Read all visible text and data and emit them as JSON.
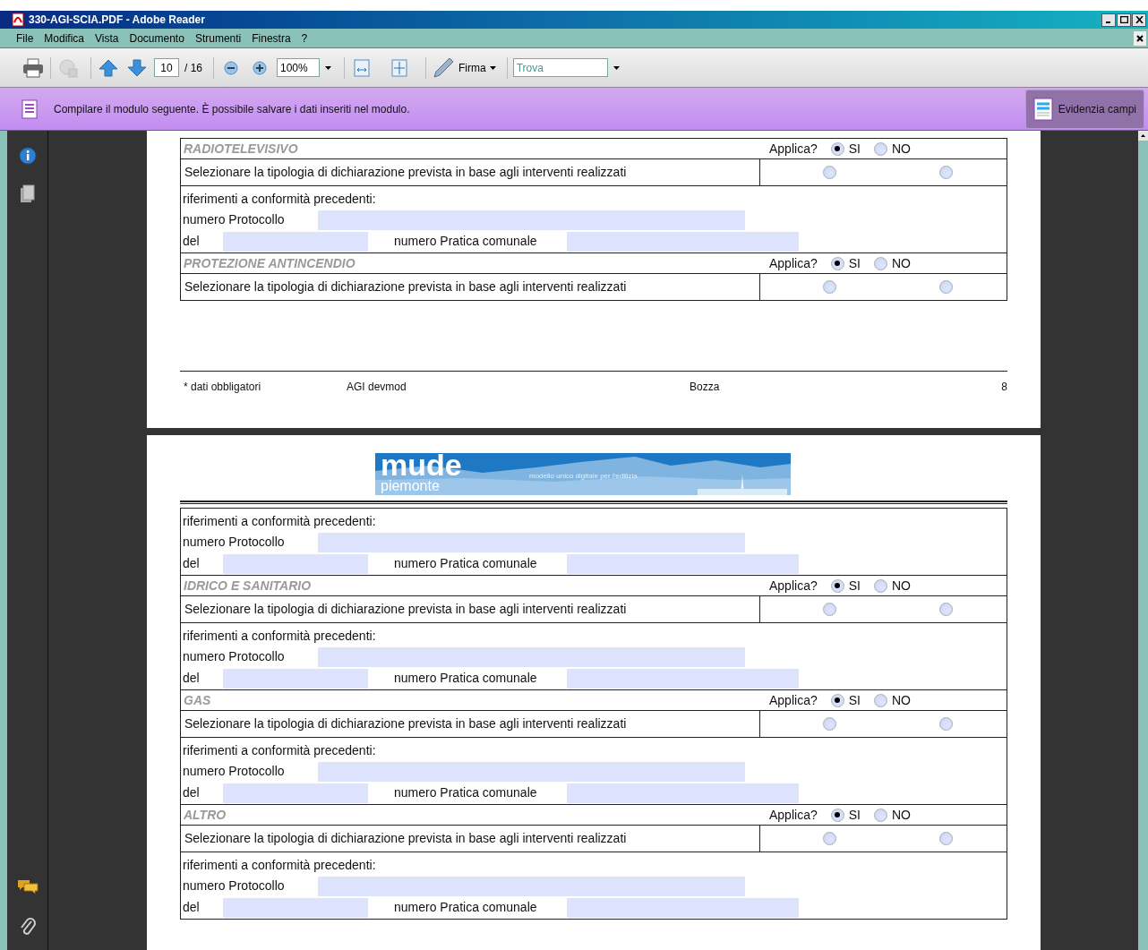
{
  "window": {
    "title": "330-AGI-SCIA.PDF - Adobe Reader"
  },
  "menu": [
    "File",
    "Modifica",
    "Vista",
    "Documento",
    "Strumenti",
    "Finestra",
    "?"
  ],
  "toolbar": {
    "page_number": "10",
    "page_total": "/ 16",
    "zoom": "100%",
    "sign_label": "Firma",
    "search_placeholder": "Trova"
  },
  "notice": {
    "text": "Compilare il modulo seguente. È possibile salvare i dati inseriti nel modulo.",
    "button": "Evidenzia campi"
  },
  "page_1": {
    "rows": [
      {
        "kind": "header",
        "title": "RADIOTELEVISIVO",
        "question": "Applica?",
        "options": [
          {
            "label": "SI",
            "selected": true
          },
          {
            "label": "NO",
            "selected": false
          }
        ]
      },
      {
        "kind": "select",
        "label": "Selezionare la tipologia di dichiarazione prevista in base agli interventi realizzati",
        "options": [
          {
            "selected": false
          },
          {
            "selected": false
          }
        ]
      },
      {
        "kind": "refs",
        "heading": "riferimenti a conformità precedenti:",
        "protocol_label": "numero Protocollo",
        "date_label": "del",
        "pratica_label": "numero Pratica comunale"
      },
      {
        "kind": "header",
        "title": "PROTEZIONE ANTINCENDIO",
        "question": "Applica?",
        "options": [
          {
            "label": "SI",
            "selected": true
          },
          {
            "label": "NO",
            "selected": false
          }
        ]
      },
      {
        "kind": "select",
        "label": "Selezionare la tipologia di dichiarazione prevista in base agli interventi realizzati",
        "options": [
          {
            "selected": false
          },
          {
            "selected": false
          }
        ]
      }
    ],
    "footer": {
      "note": "* dati obbligatori",
      "code": "AGI devmod",
      "status": "Bozza",
      "page": "8"
    }
  },
  "page_2": {
    "logo": {
      "wordmark": "mude",
      "region": "piemonte",
      "tagline": "modello unico digitale per l'edilizia"
    },
    "rows": [
      {
        "kind": "refs",
        "heading": "riferimenti a conformità precedenti:",
        "protocol_label": "numero Protocollo",
        "date_label": "del",
        "pratica_label": "numero Pratica comunale"
      },
      {
        "kind": "header",
        "title": "IDRICO E SANITARIO",
        "question": "Applica?",
        "options": [
          {
            "label": "SI",
            "selected": true
          },
          {
            "label": "NO",
            "selected": false
          }
        ]
      },
      {
        "kind": "select",
        "label": "Selezionare la tipologia di dichiarazione prevista in base agli interventi realizzati",
        "options": [
          {
            "selected": false
          },
          {
            "selected": false
          }
        ]
      },
      {
        "kind": "refs",
        "heading": "riferimenti a conformità precedenti:",
        "protocol_label": "numero Protocollo",
        "date_label": "del",
        "pratica_label": "numero Pratica comunale"
      },
      {
        "kind": "header",
        "title": "GAS",
        "question": "Applica?",
        "options": [
          {
            "label": "SI",
            "selected": true
          },
          {
            "label": "NO",
            "selected": false
          }
        ]
      },
      {
        "kind": "select",
        "label": "Selezionare la tipologia di dichiarazione prevista in base agli interventi realizzati",
        "options": [
          {
            "selected": false
          },
          {
            "selected": false
          }
        ]
      },
      {
        "kind": "refs",
        "heading": "riferimenti a conformità precedenti:",
        "protocol_label": "numero Protocollo",
        "date_label": "del",
        "pratica_label": "numero Pratica comunale"
      },
      {
        "kind": "header",
        "title": "ALTRO",
        "question": "Applica?",
        "options": [
          {
            "label": "SI",
            "selected": true
          },
          {
            "label": "NO",
            "selected": false
          }
        ]
      },
      {
        "kind": "select",
        "label": "Selezionare la tipologia di dichiarazione prevista in base agli interventi realizzati",
        "options": [
          {
            "selected": false
          },
          {
            "selected": false
          }
        ]
      },
      {
        "kind": "refs",
        "heading": "riferimenti a conformità precedenti:",
        "protocol_label": "numero Protocollo",
        "date_label": "del",
        "pratica_label": "numero Pratica comunale"
      }
    ]
  }
}
